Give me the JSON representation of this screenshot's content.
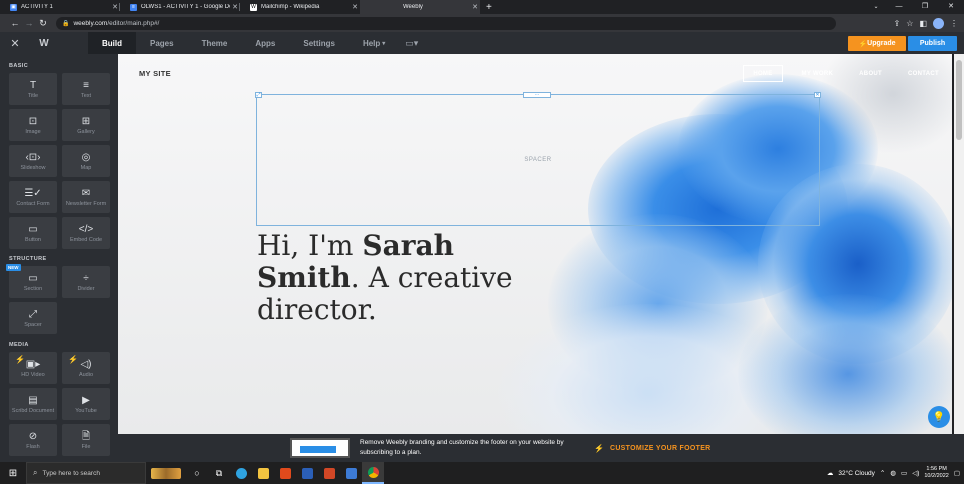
{
  "browser": {
    "tabs": [
      {
        "title": "ACTIVITY 1",
        "favicon": "classroom-icon",
        "color": "#4285f4"
      },
      {
        "title": "OLWS1 - ACTIVITY 1 - Google Docs",
        "favicon": "docs-icon",
        "color": "#4285f4"
      },
      {
        "title": "Mailchimp - Wikipedia",
        "favicon": "wikipedia-icon",
        "color": "#ffffff"
      },
      {
        "title": "Weebly",
        "favicon": "weebly-icon",
        "color": "#2a8ee6"
      }
    ],
    "url_host": "weebly.com",
    "url_path": "/editor/main.php#/"
  },
  "editor": {
    "menu": {
      "build": "Build",
      "pages": "Pages",
      "theme": "Theme",
      "apps": "Apps",
      "settings": "Settings",
      "help": "Help"
    },
    "upgrade_label": "Upgrade",
    "publish_label": "Publish"
  },
  "sidebar": {
    "basic_heading": "BASIC",
    "structure_heading": "STRUCTURE",
    "media_heading": "MEDIA",
    "new_badge": "NEW",
    "elements": {
      "title": "Title",
      "text": "Text",
      "image": "Image",
      "gallery": "Gallery",
      "slideshow": "Slideshow",
      "map": "Map",
      "contact_form": "Contact Form",
      "newsletter_form": "Newsletter Form",
      "button": "Button",
      "embed_code": "Embed Code",
      "section": "Section",
      "divider": "Divider",
      "spacer": "Spacer",
      "hd_video": "HD Video",
      "audio": "Audio",
      "scribd_document": "Scribd Document",
      "youtube": "YouTube",
      "flash": "Flash",
      "file": "File"
    }
  },
  "site": {
    "title": "MY SITE",
    "nav": [
      "HOME",
      "MY WORK",
      "ABOUT",
      "CONTACT"
    ],
    "spacer_label": "SPACER",
    "hero_1": "Hi, I'm ",
    "hero_name_1": "Sarah",
    "hero_name_2": "Smith",
    "hero_2": ". A creative director."
  },
  "footer_promo": {
    "message": "Remove Weebly branding and customize the footer on your website by subscribing to a plan.",
    "cta": "CUSTOMIZE YOUR FOOTER"
  },
  "taskbar": {
    "search_placeholder": "Type here to search",
    "weather": "32°C  Cloudy",
    "time": "1:56 PM",
    "date": "10/2/2022"
  },
  "colors": {
    "accent_blue": "#2a8ee6",
    "upgrade_orange": "#f5931f",
    "editor_dark": "#2b2e33"
  }
}
